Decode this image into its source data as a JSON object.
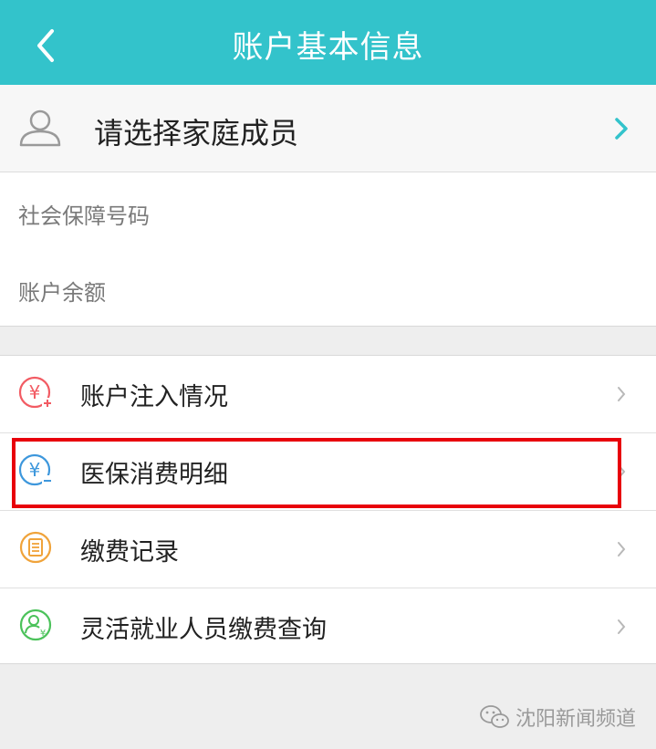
{
  "header": {
    "title": "账户基本信息",
    "back_icon": "chevron-left-icon",
    "background": "#33c3cb"
  },
  "member_selector": {
    "label": "请选择家庭成员",
    "icon": "person-icon",
    "arrow_icon": "chevron-right-icon"
  },
  "info": {
    "social_security_label": "社会保障号码",
    "balance_label": "账户余额"
  },
  "menu": {
    "items": [
      {
        "label": "账户注入情况",
        "icon": "yuan-plus-icon",
        "color": "#f25b63"
      },
      {
        "label": "医保消费明细",
        "icon": "yuan-minus-icon",
        "color": "#3d97dc"
      },
      {
        "label": "缴费记录",
        "icon": "document-icon",
        "color": "#f0a33a"
      },
      {
        "label": "灵活就业人员缴费查询",
        "icon": "person-yuan-icon",
        "color": "#4bc25a"
      }
    ]
  },
  "highlight_color": "#e8000b",
  "watermark": {
    "text": "沈阳新闻频道",
    "icon": "wechat-icon"
  }
}
